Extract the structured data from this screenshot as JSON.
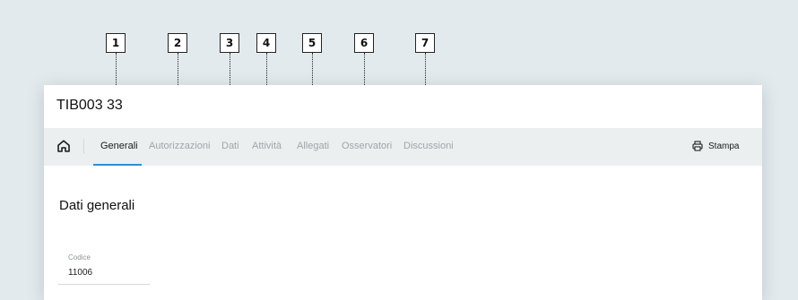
{
  "callouts": [
    "1",
    "2",
    "3",
    "4",
    "5",
    "6",
    "7"
  ],
  "record": {
    "title": "TIB003 33"
  },
  "tabs": [
    {
      "label": "Generali",
      "active": true
    },
    {
      "label": "Autorizzazioni",
      "active": false
    },
    {
      "label": "Dati",
      "active": false
    },
    {
      "label": "Attività",
      "active": false
    },
    {
      "label": "Allegati",
      "active": false
    },
    {
      "label": "Osservatori",
      "active": false
    },
    {
      "label": "Discussioni",
      "active": false
    }
  ],
  "toolbar": {
    "print_label": "Stampa",
    "home_icon": "home-icon",
    "print_icon": "printer-icon"
  },
  "section": {
    "title": "Dati generali"
  },
  "fields": [
    {
      "label": "Codice",
      "value": "11006"
    }
  ],
  "colors": {
    "accent": "#2c8fd6",
    "background": "#e3eaee",
    "navbar": "#ebeff0"
  }
}
